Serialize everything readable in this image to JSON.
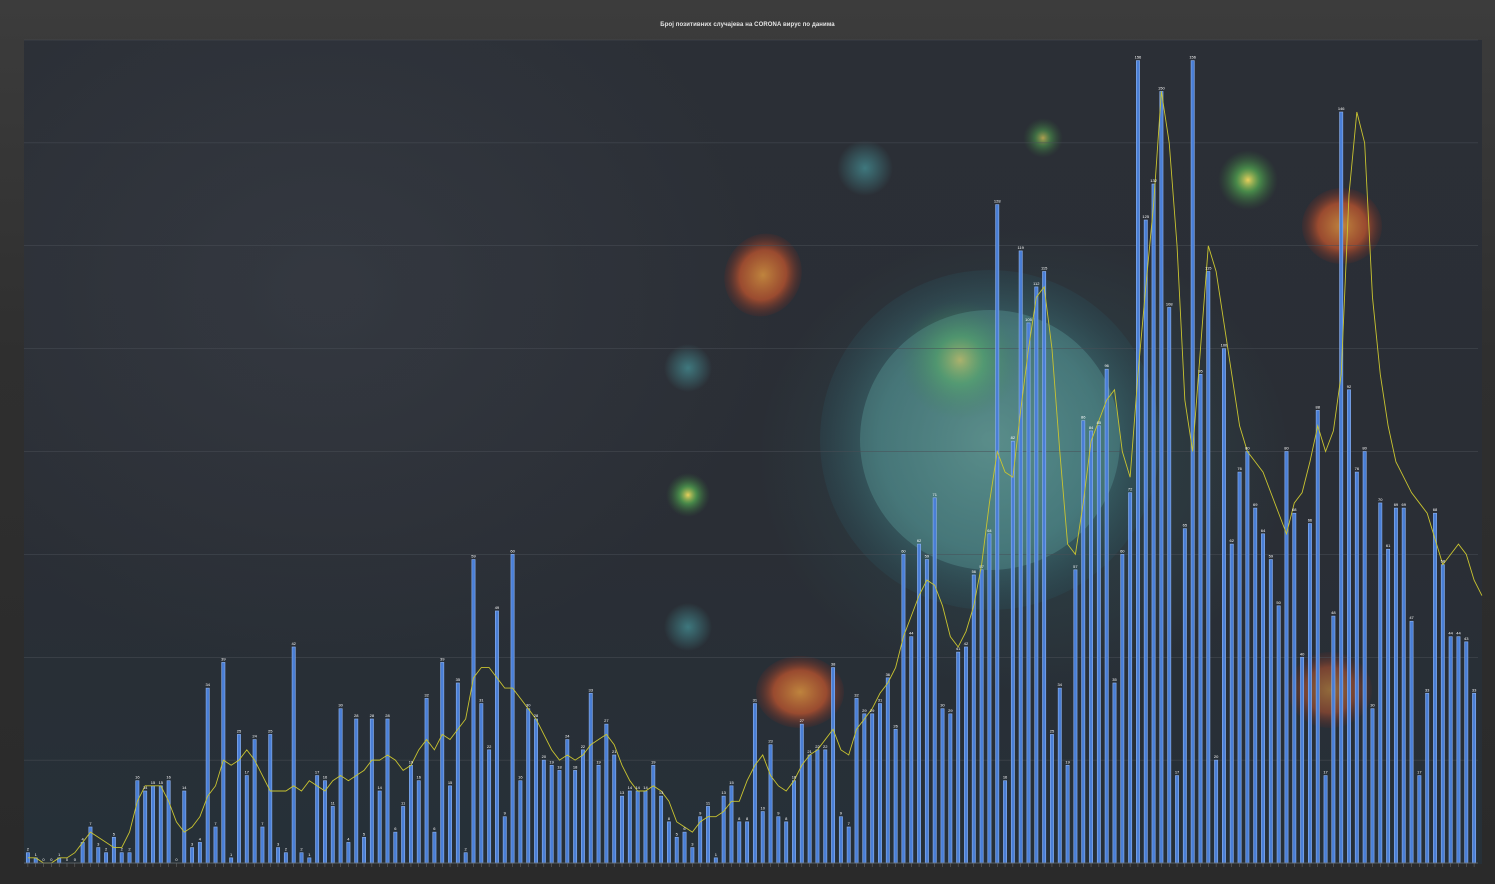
{
  "page": {
    "title": "Број позитивних случајева на CORONA вирус по данима"
  },
  "colors": {
    "bar": "#4a7fd6",
    "trend": "#c9c430",
    "background": "#2b2f36"
  },
  "chart_data": {
    "type": "bar",
    "title": "Број позитивних случајева на CORONA вирус по данима",
    "xlabel": "",
    "ylabel": "",
    "ylim": [
      0,
      160
    ],
    "grid": true,
    "legend": "none",
    "trendline": "moving-average",
    "series": [
      {
        "name": "",
        "values": [
          2,
          1,
          0,
          0,
          1,
          0,
          0,
          4,
          7,
          3,
          2,
          5,
          2,
          2,
          16,
          14,
          15,
          15,
          16,
          0,
          14,
          3,
          4,
          34,
          7,
          39,
          1,
          25,
          17,
          24,
          7,
          25,
          3,
          2,
          42,
          2,
          1,
          17,
          16,
          11,
          30,
          4,
          28,
          5,
          28,
          14,
          28,
          6,
          11,
          19,
          16,
          32,
          6,
          39,
          15,
          35,
          2,
          59,
          31,
          22,
          49,
          9,
          60,
          16,
          30,
          28,
          20,
          19,
          18,
          24,
          18,
          22,
          33,
          19,
          27,
          21,
          13,
          14,
          14,
          14,
          19,
          13,
          8,
          5,
          6,
          3,
          9,
          11,
          1,
          13,
          15,
          8,
          8,
          31,
          10,
          23,
          9,
          8,
          16,
          27,
          21,
          22,
          22,
          38,
          9,
          7,
          32,
          29,
          29,
          31,
          36,
          26,
          60,
          44,
          62,
          59,
          71,
          30,
          29,
          41,
          42,
          56,
          57,
          64,
          128,
          16,
          82,
          119,
          105,
          112,
          115,
          25,
          34,
          19,
          57,
          86,
          84,
          85,
          96,
          35,
          60,
          72,
          156,
          125,
          132,
          150,
          108,
          17,
          65,
          156,
          95,
          115,
          20,
          100,
          62,
          76,
          80,
          69,
          64,
          59,
          50,
          80,
          68,
          40,
          66,
          88,
          17,
          48,
          146,
          92,
          76,
          80,
          30,
          70,
          61,
          69,
          69,
          47,
          17,
          33,
          68,
          58,
          44,
          44,
          43,
          33
        ]
      }
    ],
    "trend_values": [
      1,
      1,
      0,
      0,
      1,
      1,
      2,
      4,
      6,
      5,
      4,
      3,
      3,
      6,
      12,
      15,
      15,
      15,
      12,
      8,
      6,
      7,
      9,
      13,
      15,
      20,
      19,
      20,
      22,
      20,
      17,
      14,
      14,
      14,
      15,
      14,
      16,
      15,
      14,
      16,
      17,
      16,
      17,
      18,
      20,
      20,
      21,
      20,
      18,
      19,
      22,
      24,
      22,
      25,
      24,
      26,
      28,
      36,
      38,
      38,
      36,
      34,
      34,
      32,
      30,
      28,
      25,
      22,
      20,
      21,
      20,
      21,
      23,
      24,
      25,
      23,
      19,
      16,
      14,
      14,
      15,
      14,
      12,
      8,
      7,
      6,
      8,
      9,
      9,
      10,
      12,
      12,
      16,
      19,
      21,
      17,
      15,
      14,
      16,
      19,
      21,
      22,
      24,
      26,
      22,
      21,
      26,
      28,
      30,
      33,
      35,
      38,
      44,
      48,
      52,
      55,
      54,
      50,
      44,
      42,
      45,
      50,
      58,
      70,
      80,
      76,
      75,
      88,
      100,
      110,
      112,
      100,
      80,
      62,
      60,
      70,
      82,
      86,
      90,
      92,
      80,
      75,
      95,
      112,
      128,
      150,
      140,
      120,
      90,
      80,
      100,
      120,
      115,
      105,
      95,
      85,
      80,
      78,
      76,
      72,
      68,
      64,
      70,
      72,
      78,
      85,
      80,
      84,
      95,
      130,
      146,
      140,
      110,
      95,
      85,
      78,
      75,
      72,
      70,
      68,
      63,
      58,
      60,
      62,
      60,
      55,
      52
    ]
  }
}
